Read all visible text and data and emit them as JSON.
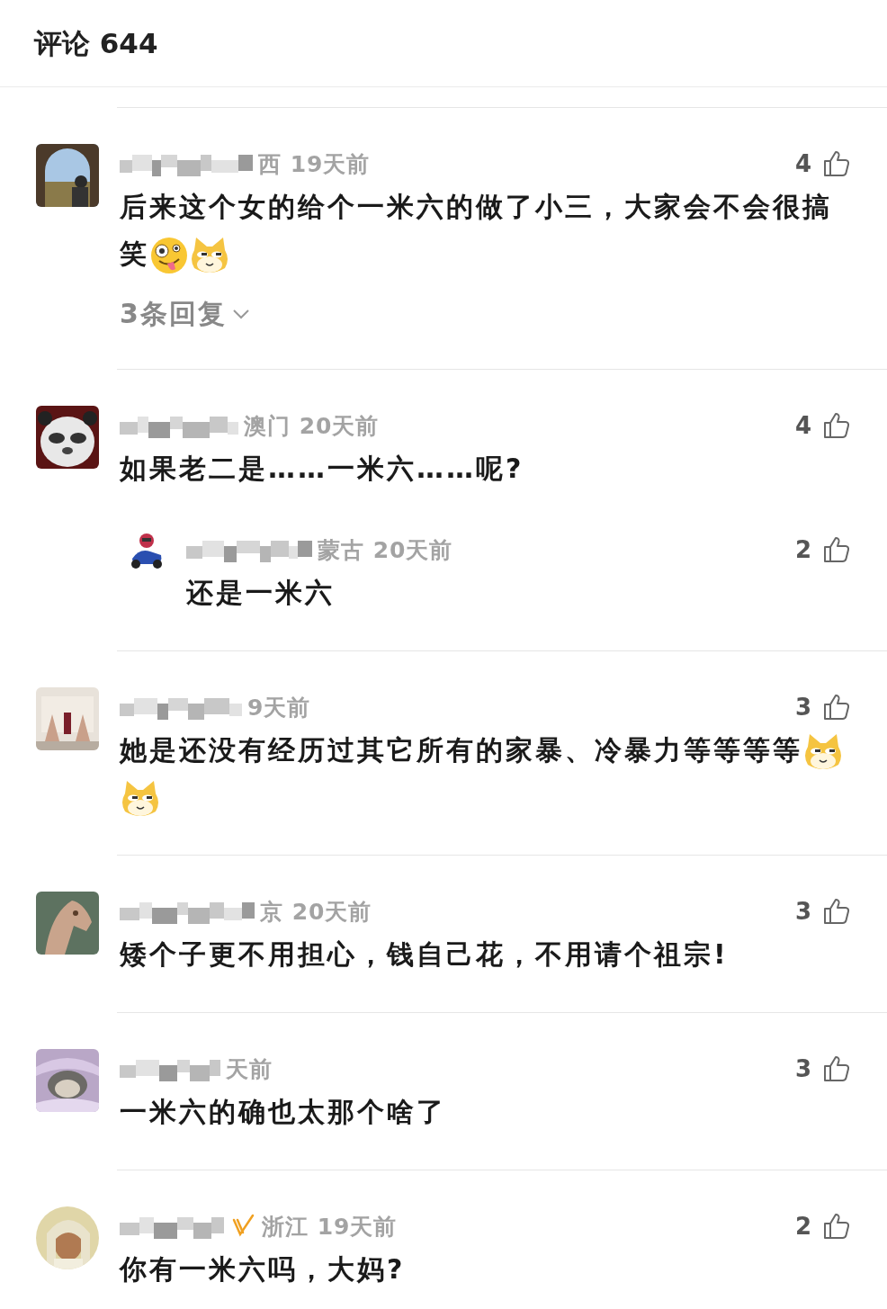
{
  "header": {
    "title": "评论 644"
  },
  "comments": [
    {
      "avatar": {
        "kind": "picture",
        "round": false
      },
      "verified": false,
      "meta": "西 19天前",
      "likes": "4",
      "text": "后来这个女的给个一米六的做了小三，大家会不会很搞笑",
      "emojis": [
        {
          "kind": "zany"
        },
        {
          "kind": "doge"
        }
      ],
      "reply_link": "3条回复"
    },
    {
      "avatar": {
        "kind": "picture",
        "round": false
      },
      "verified": false,
      "meta": "澳门 20天前",
      "likes": "4",
      "text": "如果老二是……一米六……呢?",
      "replies": [
        {
          "meta": "蒙古 20天前",
          "likes": "2",
          "text": "还是一米六"
        }
      ]
    },
    {
      "avatar": {
        "kind": "picture",
        "round": false
      },
      "verified": false,
      "meta": "9天前",
      "likes": "3",
      "text": "她是还没有经历过其它所有的家暴、冷暴力等等等等",
      "emojis": [
        {
          "kind": "doge"
        },
        {
          "kind": "doge"
        }
      ]
    },
    {
      "avatar": {
        "kind": "picture",
        "round": false
      },
      "verified": false,
      "meta": "京 20天前",
      "likes": "3",
      "text": "矮个子更不用担心，钱自己花，不用请个祖宗!"
    },
    {
      "avatar": {
        "kind": "picture",
        "round": false
      },
      "verified": false,
      "meta": "天前",
      "likes": "3",
      "text": "一米六的确也太那个啥了"
    },
    {
      "avatar": {
        "kind": "picture",
        "round": true
      },
      "verified": true,
      "meta": "浙江 19天前",
      "likes": "2",
      "text": "你有一米六吗，大妈?"
    }
  ]
}
